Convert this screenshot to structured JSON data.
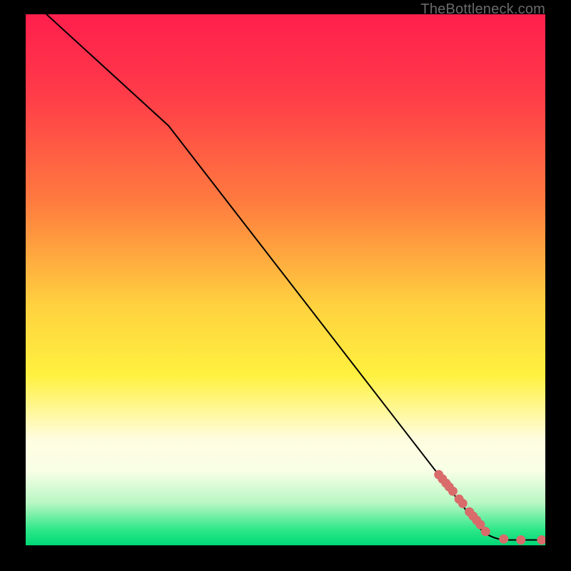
{
  "watermark": "TheBottleneck.com",
  "chart_data": {
    "type": "line",
    "title": "",
    "xlabel": "",
    "ylabel": "",
    "xlim": [
      0,
      100
    ],
    "ylim": [
      0,
      100
    ],
    "gradient_stops": [
      {
        "pct": 0,
        "color": "#ff1f4d"
      },
      {
        "pct": 15,
        "color": "#ff3b49"
      },
      {
        "pct": 35,
        "color": "#ff7a3f"
      },
      {
        "pct": 55,
        "color": "#ffd23f"
      },
      {
        "pct": 68,
        "color": "#fff13f"
      },
      {
        "pct": 80,
        "color": "#fffde0"
      },
      {
        "pct": 86,
        "color": "#f8ffe6"
      },
      {
        "pct": 92,
        "color": "#b8f7c4"
      },
      {
        "pct": 97,
        "color": "#2fe889"
      },
      {
        "pct": 100,
        "color": "#00d876"
      }
    ],
    "series": [
      {
        "name": "curve",
        "type": "line",
        "color": "#000000",
        "stroke_width": 2,
        "points": [
          {
            "x": 4.0,
            "y": 100.0
          },
          {
            "x": 27.5,
            "y": 79.0
          },
          {
            "x": 88.0,
            "y": 2.5
          },
          {
            "x": 92.0,
            "y": 1.0
          },
          {
            "x": 100.0,
            "y": 1.0
          }
        ]
      },
      {
        "name": "markers",
        "type": "scatter",
        "color": "#d96b6b",
        "radius": 6.5,
        "points": [
          {
            "x": 79.5,
            "y": 13.3
          },
          {
            "x": 80.2,
            "y": 12.5
          },
          {
            "x": 80.9,
            "y": 11.7
          },
          {
            "x": 81.5,
            "y": 11.0
          },
          {
            "x": 82.2,
            "y": 10.2
          },
          {
            "x": 83.4,
            "y": 8.7
          },
          {
            "x": 84.1,
            "y": 7.9
          },
          {
            "x": 85.4,
            "y": 6.3
          },
          {
            "x": 86.1,
            "y": 5.5
          },
          {
            "x": 86.8,
            "y": 4.7
          },
          {
            "x": 87.5,
            "y": 3.9
          },
          {
            "x": 88.5,
            "y": 2.6
          },
          {
            "x": 92.0,
            "y": 1.2
          },
          {
            "x": 95.3,
            "y": 1.0
          },
          {
            "x": 99.3,
            "y": 1.0
          }
        ]
      }
    ]
  }
}
